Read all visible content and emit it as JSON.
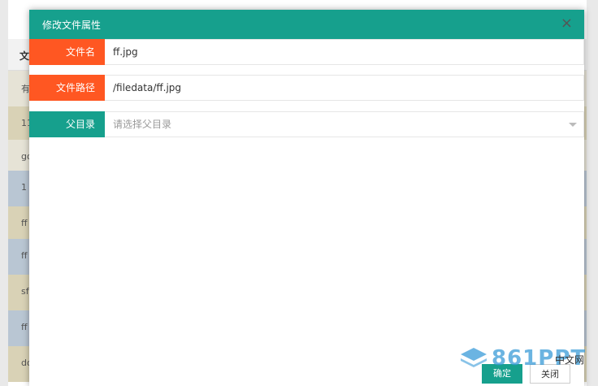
{
  "background_table": {
    "header": "文",
    "rows": [
      "有",
      "11",
      "go",
      "1",
      "ff",
      "ff",
      "sf",
      "ff",
      "do"
    ]
  },
  "modal": {
    "title": "修改文件属性",
    "close_symbol": "×",
    "fields": [
      {
        "label": "文件名",
        "value": "ff.jpg"
      },
      {
        "label": "文件路径",
        "value": "/filedata/ff.jpg"
      },
      {
        "label": "父目录",
        "placeholder": "请选择父目录"
      }
    ],
    "buttons": {
      "ok": "确定",
      "close": "关闭"
    }
  },
  "watermark": {
    "logo": "861PPT",
    "sub": "中文网"
  },
  "colors": {
    "teal": "#16a08d",
    "orange": "#ff5722"
  }
}
